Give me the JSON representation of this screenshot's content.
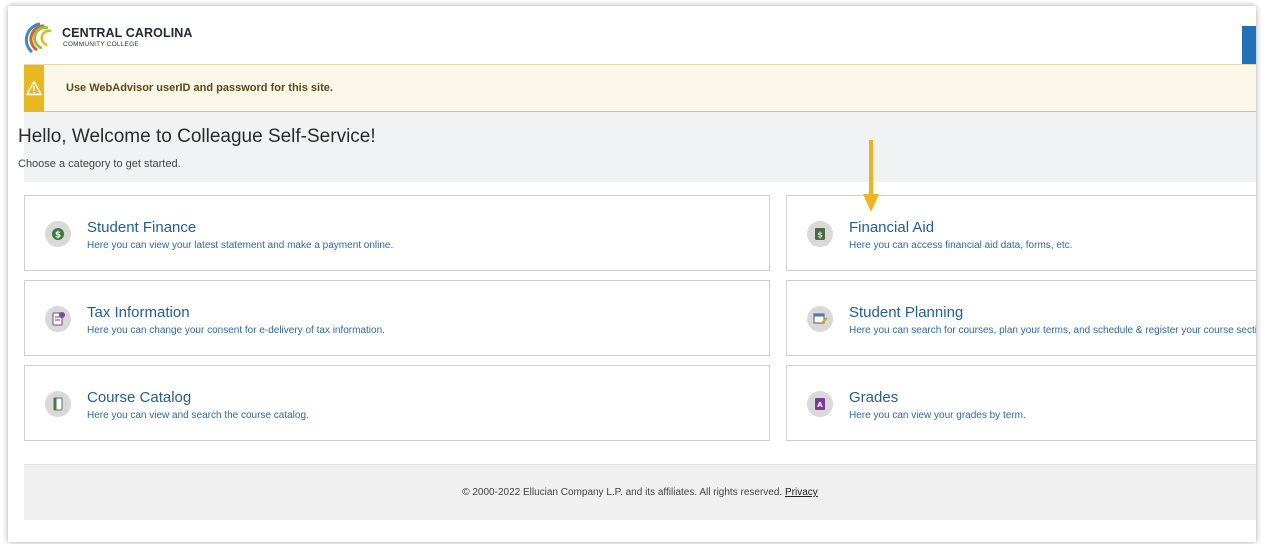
{
  "header": {
    "college_name": "CENTRAL CAROLINA",
    "college_sub": "COMMUNITY COLLEGE",
    "logo_icon": "ccc-arcs-logo-icon",
    "accent_color": "#1d72b8"
  },
  "alert": {
    "icon": "warning-triangle-icon",
    "text": "Use WebAdvisor userID and password for this site.",
    "color": "#e8b820"
  },
  "welcome": {
    "title": "Hello, Welcome to Colleague Self-Service!",
    "subtitle": "Choose a category to get started."
  },
  "annotation": {
    "arrow_icon": "down-arrow-annotation-icon",
    "arrow_color": "#f2b21c"
  },
  "cards": [
    {
      "title": "Student Finance",
      "description": "Here you can view your latest statement and make a payment online.",
      "icon": "dollar-coin-icon"
    },
    {
      "title": "Financial Aid",
      "description": "Here you can access financial aid data, forms, etc.",
      "icon": "money-document-icon"
    },
    {
      "title": "Tax Information",
      "description": "Here you can change your consent for e-delivery of tax information.",
      "icon": "tax-document-icon"
    },
    {
      "title": "Student Planning",
      "description": "Here you can search for courses, plan your terms, and schedule & register your course sections.",
      "icon": "calendar-pencil-icon"
    },
    {
      "title": "Course Catalog",
      "description": "Here you can view and search the course catalog.",
      "icon": "book-icon"
    },
    {
      "title": "Grades",
      "description": "Here you can view your grades by term.",
      "icon": "grade-badge-icon"
    }
  ],
  "footer": {
    "copyright": "© 2000-2022 Ellucian Company L.P. and its affiliates. All rights reserved.",
    "privacy_link": "Privacy"
  }
}
